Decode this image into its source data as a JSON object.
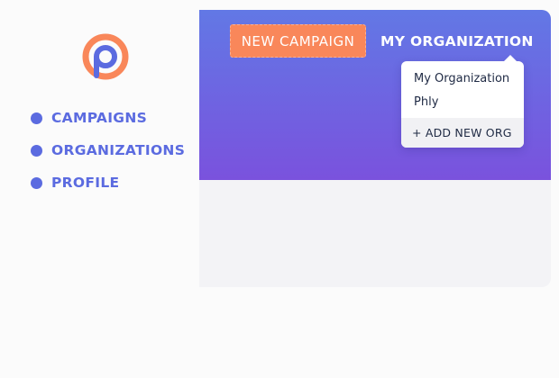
{
  "sidebar": {
    "logo_icon": "p-logo-icon",
    "accent_color": "#5b6be0",
    "items": [
      {
        "label": "CAMPAIGNS"
      },
      {
        "label": "ORGANIZATIONS"
      },
      {
        "label": "PROFILE"
      }
    ]
  },
  "header": {
    "new_campaign_label": "NEW CAMPAIGN",
    "org_menu_label": "MY ORGANIZATION",
    "button_color": "#f9875a",
    "gradient_top": "#6278e5",
    "gradient_bottom": "#7a52dd"
  },
  "org_dropdown": {
    "items": [
      {
        "label": "My Organization"
      },
      {
        "label": "Phly"
      }
    ],
    "add_label": "+ ADD NEW ORG"
  }
}
